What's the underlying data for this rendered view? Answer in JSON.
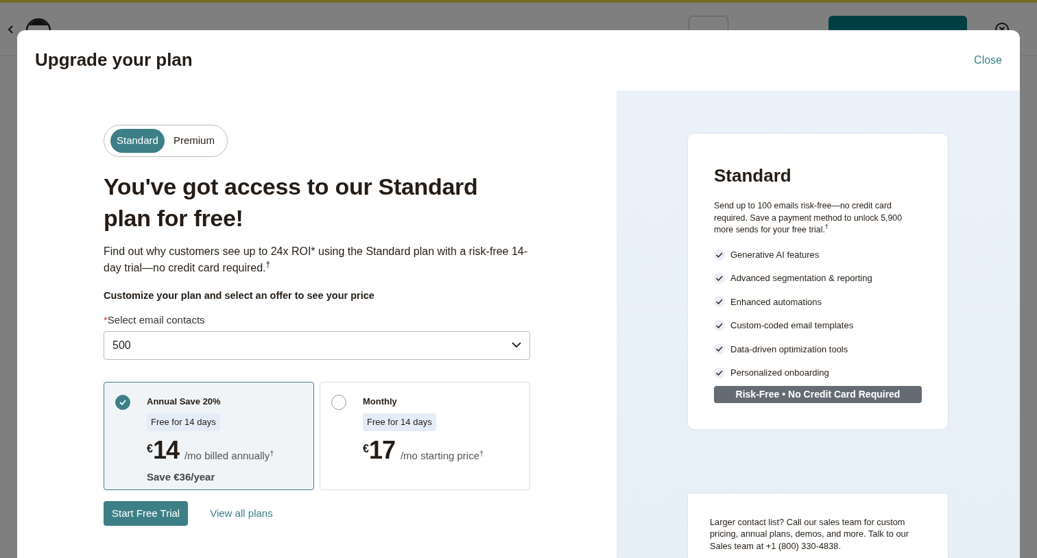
{
  "modal": {
    "title": "Upgrade your plan",
    "close": "Close"
  },
  "plan_tabs": [
    {
      "label": "Standard",
      "selected": true
    },
    {
      "label": "Premium",
      "selected": false
    }
  ],
  "heading": "You've got access to our Standard plan for free!",
  "intro": "Find out why customers see up to 24x ROI* using the Standard plan with a risk-free 14-day trial—no credit card required.$^{†}$",
  "customize_label": "Customize your plan and select an offer to see your price",
  "contacts_field": {
    "required_mark": "*",
    "label": "Select email contacts",
    "value": "500"
  },
  "offers": [
    {
      "title": "Annual Save 20%",
      "badge": "Free for 14 days",
      "currency": "€",
      "price": "14",
      "period": "/mo billed annually$^{†}$",
      "savings": "Save €36/year",
      "selected": true
    },
    {
      "title": "Monthly",
      "badge": "Free for 14 days",
      "currency": "€",
      "price": "17",
      "period": "/mo starting price$^{†}$",
      "selected": false
    }
  ],
  "actions": {
    "primary": "Start Free Trial",
    "link": "View all plans"
  },
  "plan_card": {
    "title": "Standard",
    "description": "Send up to 100 emails risk-free—no credit card required. Save a payment method to unlock 5,900 more sends for your free trial.$^{†}$",
    "features": [
      "Generative AI features",
      "Advanced segmentation & reporting",
      "Enhanced automations",
      "Custom-coded email templates",
      "Data-driven optimization tools",
      "Personalized onboarding"
    ],
    "banner": "Risk-Free • No Credit Card Required"
  },
  "sales_note": "Larger contact list? Call our sales team for custom pricing, annual plans, demos, and more. Talk to our Sales team at +1 (800) 330-4838."
}
